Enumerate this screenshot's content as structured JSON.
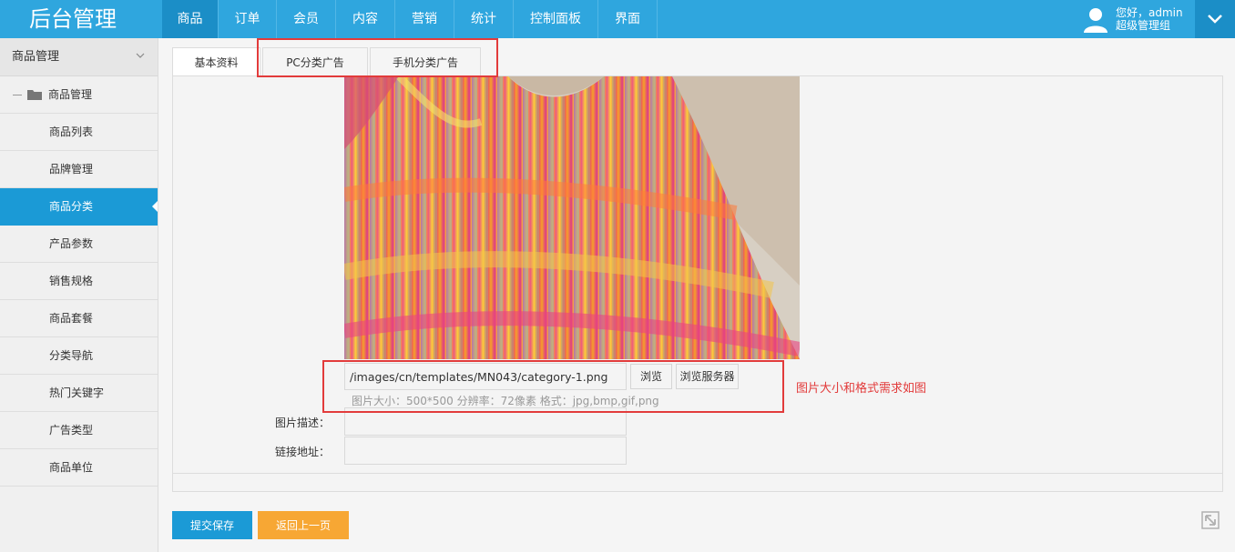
{
  "logo": "后台管理",
  "nav": [
    {
      "label": "商品",
      "active": true
    },
    {
      "label": "订单"
    },
    {
      "label": "会员"
    },
    {
      "label": "内容"
    },
    {
      "label": "营销"
    },
    {
      "label": "统计"
    },
    {
      "label": "控制面板"
    },
    {
      "label": "界面"
    }
  ],
  "user": {
    "greeting": "您好，admin",
    "role": "超级管理组"
  },
  "sidebar": {
    "header": "商品管理",
    "group": "商品管理",
    "items": [
      {
        "label": "商品列表"
      },
      {
        "label": "品牌管理"
      },
      {
        "label": "商品分类",
        "active": true
      },
      {
        "label": "产品参数"
      },
      {
        "label": "销售规格"
      },
      {
        "label": "商品套餐"
      },
      {
        "label": "分类导航"
      },
      {
        "label": "热门关键字"
      },
      {
        "label": "广告类型"
      },
      {
        "label": "商品单位"
      }
    ]
  },
  "tabs": [
    {
      "label": "基本资料",
      "active": true
    },
    {
      "label": "PC分类广告"
    },
    {
      "label": "手机分类广告"
    }
  ],
  "form": {
    "image_path": "/images/cn/templates/MN043/category-1.png",
    "browse_label": "浏览",
    "browse_server_label": "浏览服务器",
    "hint": "图片大小：500*500 分辨率：72像素 格式：jpg,bmp,gif,png",
    "desc_label": "图片描述：",
    "link_label": "链接地址："
  },
  "annotation": "图片大小和格式需求如图",
  "buttons": {
    "submit": "提交保存",
    "back": "返回上一页"
  },
  "colors": {
    "topbar": "#2fa6de",
    "active": "#1b9ad6",
    "back": "#f7a734",
    "annotation": "#e23b3b"
  }
}
